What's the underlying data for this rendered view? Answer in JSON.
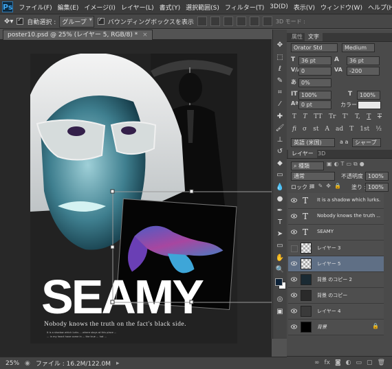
{
  "menubar": {
    "logo": "Ps",
    "items": [
      "ファイル(F)",
      "編集(E)",
      "イメージ(I)",
      "レイヤー(L)",
      "書式(Y)",
      "選択範囲(S)",
      "フィルター(T)",
      "3D(D)",
      "表示(V)",
      "ウィンドウ(W)",
      "ヘルプ(H)"
    ]
  },
  "options": {
    "auto_select_label": "自動選択 :",
    "auto_select_value": "グループ",
    "bbox_label": "バウンディングボックスを表示",
    "mode_3d": "3D モード :"
  },
  "document": {
    "tab_title": "poster10.psd @ 25% (レイヤー 5, RGB/8) *",
    "close": "×"
  },
  "poster": {
    "title": "SEAMY",
    "tagline": "Nobody knows the truth on the fact's black side.",
    "small_text_1": "It is a shadow which lurks ... where stays at this place ...",
    "small_text_2": "... in my heart have come in ... the true ... hat ..."
  },
  "character_panel": {
    "tabs": [
      "属性",
      "文字"
    ],
    "font_family": "Orator Std",
    "font_style": "Medium",
    "font_size": "36 pt",
    "leading": "36 pt",
    "kerning": "0",
    "tracking": "-200",
    "baseline_pct": "0%",
    "vscale": "100%",
    "hscale": "100%",
    "baseline_shift": "0 pt",
    "color_label": "カラー :",
    "language": "英語 (米国)",
    "aa_method": "シャープ",
    "aa_label": "a a",
    "style_buttons": [
      "T",
      "T",
      "TT",
      "Tr",
      "T'",
      "T,",
      "T",
      "T"
    ],
    "ot_buttons": [
      "fi",
      "σ",
      "st",
      "A",
      "ad",
      "T",
      "1st",
      "½"
    ]
  },
  "layers_panel": {
    "tabs": [
      "レイヤー",
      "3D"
    ],
    "filter_label": "種類",
    "blend_mode": "通常",
    "opacity_label": "不透明度 :",
    "opacity": "100%",
    "lock_label": "ロック :",
    "fill_label": "塗り :",
    "fill": "100%",
    "layers": [
      {
        "name": "It is a shadow which lurks...",
        "type": "text",
        "visible": true,
        "selected": false
      },
      {
        "name": "Nobody knows the truth ...",
        "type": "text",
        "visible": true,
        "selected": false
      },
      {
        "name": "SEAMY",
        "type": "text",
        "visible": true,
        "selected": false
      },
      {
        "name": "レイヤー 3",
        "type": "image",
        "visible": false,
        "selected": false
      },
      {
        "name": "レイヤー 5",
        "type": "image",
        "visible": true,
        "selected": true
      },
      {
        "name": "背景 のコピー 2",
        "type": "image",
        "visible": true,
        "selected": false
      },
      {
        "name": "背景 のコピー",
        "type": "image",
        "visible": true,
        "selected": false
      },
      {
        "name": "レイヤー 4",
        "type": "image",
        "visible": true,
        "selected": false
      },
      {
        "name": "背景",
        "type": "image",
        "visible": true,
        "selected": false,
        "locked": true
      }
    ]
  },
  "status": {
    "zoom": "25%",
    "file_info": "ファイル : 16.2M/122.0M"
  },
  "colors": {
    "ps_blue": "#3ea6f0",
    "selection": "#5f6f85",
    "foreground": "#0d2238",
    "background": "#ffffff"
  }
}
